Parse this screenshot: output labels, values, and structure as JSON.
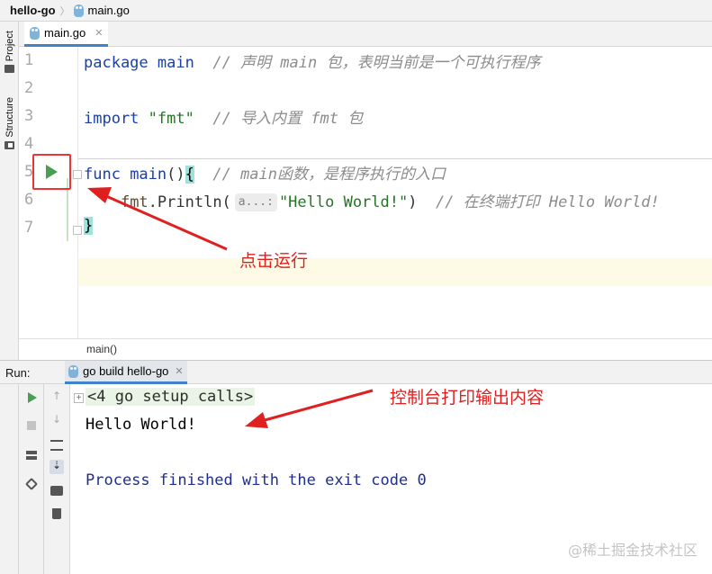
{
  "breadcrumb": {
    "project": "hello-go",
    "file": "main.go"
  },
  "toolwindows": {
    "project": "Project",
    "structure": "Structure"
  },
  "editor_tab": {
    "label": "main.go"
  },
  "lines": [
    "1",
    "2",
    "3",
    "4",
    "5",
    "6",
    "7"
  ],
  "code": {
    "l1_kw": "package",
    "l1_name": " main",
    "l1_comment": "// 声明 main 包，表明当前是一个可执行程序",
    "l3_kw": "import",
    "l3_str": " \"fmt\"",
    "l3_comment": "// 导入内置 fmt 包",
    "l5_kw": "func",
    "l5_name": " main",
    "l5_parens": "()",
    "l5_brace": "{",
    "l5_comment": "// main函数，是程序执行的入口",
    "l6_pkg": "fmt",
    "l6_call": ".Println(",
    "l6_hint": "a...:",
    "l6_str": "\"Hello World!\"",
    "l6_close": ")",
    "l6_comment": "// 在终端打印 Hello World!",
    "l7_brace": "}"
  },
  "editor_status": {
    "path": "main()"
  },
  "run_panel": {
    "label": "Run:",
    "tab": "go build hello-go"
  },
  "console": {
    "setup": "<4 go setup calls>",
    "output": "Hello World!",
    "exit": "Process finished with the exit code 0"
  },
  "annotations": {
    "run": "点击运行",
    "console": "控制台打印输出内容"
  },
  "watermark": "@稀土掘金技术社区",
  "colors": {
    "accent": "#4083c9",
    "annotation": "#e02020",
    "run_green": "#4a9e53"
  }
}
